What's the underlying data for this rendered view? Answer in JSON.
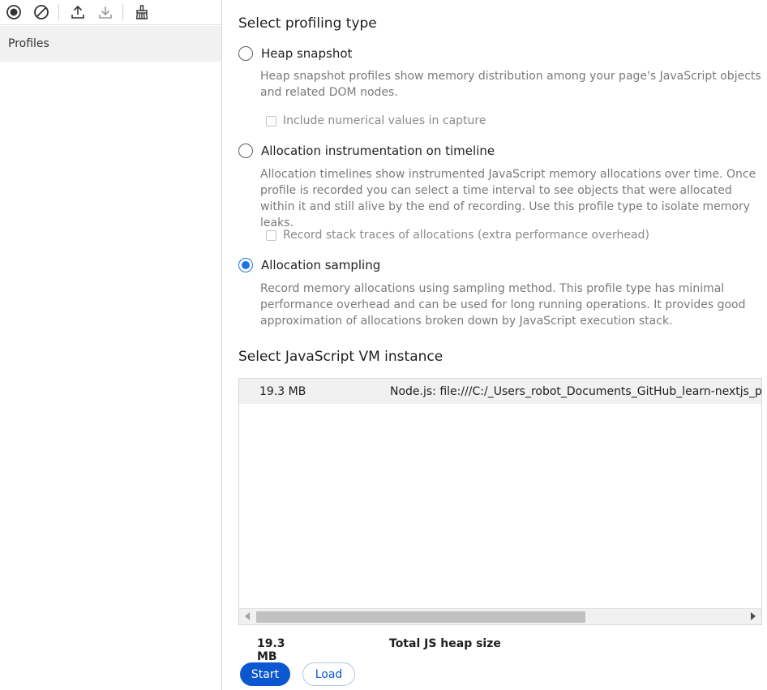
{
  "toolbar": {
    "icons": [
      "record-icon",
      "clear-icon",
      "upload-icon",
      "download-icon",
      "garbage-collect-icon"
    ]
  },
  "sidebar": {
    "items": [
      {
        "label": "Profiles"
      }
    ]
  },
  "main": {
    "profiling_heading": "Select profiling type",
    "options": [
      {
        "label": "Heap snapshot",
        "description": "Heap snapshot profiles show memory distribution among your page's JavaScript objects and related DOM nodes.",
        "checkbox_label": "Include numerical values in capture",
        "selected": false
      },
      {
        "label": "Allocation instrumentation on timeline",
        "description": "Allocation timelines show instrumented JavaScript memory allocations over time. Once profile is recorded you can select a time interval to see objects that were allocated within it and still alive by the end of recording. Use this profile type to isolate memory leaks.",
        "checkbox_label": "Record stack traces of allocations (extra performance overhead)",
        "selected": false
      },
      {
        "label": "Allocation sampling",
        "description": "Record memory allocations using sampling method. This profile type has minimal performance overhead and can be used for long running operations. It provides good approximation of allocations broken down by JavaScript execution stack.",
        "selected": true
      }
    ],
    "vm_heading": "Select JavaScript VM instance",
    "vm_instances": [
      {
        "size": "19.3 MB",
        "name": "Node.js: file:///C:/_Users_robot_Documents_GitHub_learn-nextjs_pag"
      }
    ],
    "total": {
      "size": "19.3 MB",
      "label": "Total JS heap size"
    },
    "buttons": {
      "start": "Start",
      "load": "Load"
    }
  },
  "colors": {
    "accent": "#1a73e8",
    "primary_button": "#0b57d0"
  }
}
